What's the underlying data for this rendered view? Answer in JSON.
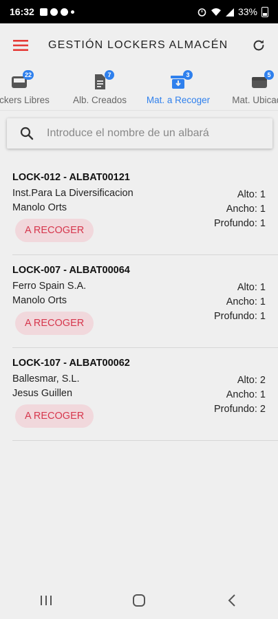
{
  "status_bar": {
    "time": "16:32",
    "battery": "33%"
  },
  "app_bar": {
    "title": "GESTIÓN LOCKERS ALMACÉN",
    "menu_icon": "hamburger-icon",
    "refresh_icon": "refresh-icon",
    "accent": "#e53935"
  },
  "tabs": [
    {
      "label": "Lockers Libres",
      "badge": "22",
      "icon": "inbox-tray-icon"
    },
    {
      "label": "Alb. Creados",
      "badge": "7",
      "icon": "document-icon"
    },
    {
      "label": "Mat. a Recoger",
      "badge": "3",
      "icon": "download-box-icon",
      "active": true
    },
    {
      "label": "Mat. Ubicado",
      "badge": "5",
      "icon": "box-icon"
    }
  ],
  "search": {
    "placeholder": "Introduce el nombre de un albará",
    "value": ""
  },
  "items": [
    {
      "code": "LOCK-012 - ALBAT00121",
      "client": "Inst.Para La Diversificacion",
      "user": "Manolo Orts",
      "status": "A RECOGER",
      "alto": "Alto: 1",
      "ancho": "Ancho: 1",
      "profundo": "Profundo: 1"
    },
    {
      "code": "LOCK-007 - ALBAT00064",
      "client": "Ferro Spain S.A.",
      "user": "Manolo Orts",
      "status": "A RECOGER",
      "alto": "Alto: 1",
      "ancho": "Ancho: 1",
      "profundo": "Profundo: 1"
    },
    {
      "code": "LOCK-107 - ALBAT00062",
      "client": "Ballesmar, S.L.",
      "user": "Jesus Guillen",
      "status": "A RECOGER",
      "alto": "Alto: 2",
      "ancho": "Ancho: 1",
      "profundo": "Profundo: 2"
    }
  ],
  "colors": {
    "tab_active": "#2f80ed",
    "chip_text": "#d6364c",
    "chip_bg": "#f1d8dc"
  }
}
